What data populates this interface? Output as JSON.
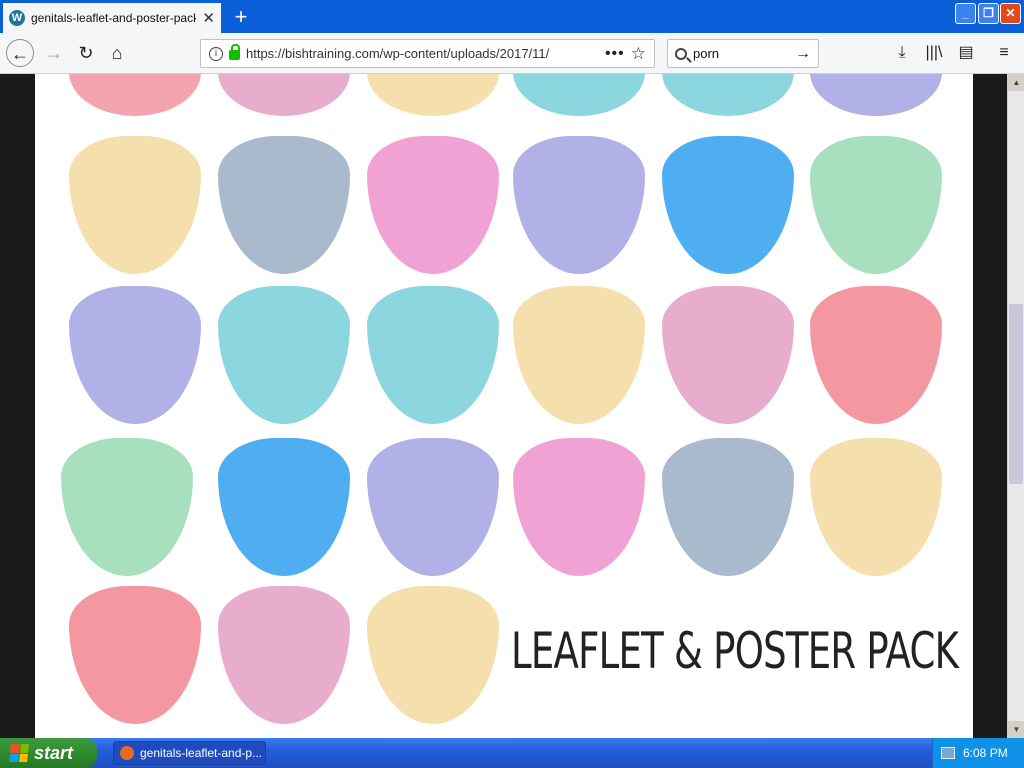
{
  "browser": {
    "tab_title": "genitals-leaflet-and-poster-pack.p",
    "url": "https://bishtraining.com/wp-content/uploads/2017/11/",
    "search_value": "porn"
  },
  "icons": {
    "tab_favicon": "wordpress-icon",
    "tab_close": "close-icon",
    "new_tab": "plus-icon",
    "back": "arrow-left-icon",
    "forward": "arrow-right-icon",
    "reload": "reload-icon",
    "home": "home-icon",
    "site_info": "info-icon",
    "secure": "lock-icon",
    "page_actions": "more-icon",
    "bookmark": "star-icon",
    "search": "search-icon",
    "search_go": "arrow-right-icon",
    "downloads": "download-icon",
    "library": "library-icon",
    "sidebar": "sidebar-icon",
    "menu": "hamburger-icon"
  },
  "page": {
    "headline": "LEAFLET & POSTER PACK"
  },
  "palette": {
    "pink": "#f29aa5",
    "rose": "#e6a3c8",
    "yellow": "#f3dca4",
    "teal": "#7fd1dc",
    "lavender": "#a9a7e4",
    "slate": "#9fb2c6",
    "magenta": "#ee98cf",
    "blue": "#3ba5ef",
    "green": "#9fdcb8",
    "red": "#f28d96"
  },
  "taskbar": {
    "start_label": "start",
    "window_label": "genitals-leaflet-and-p...",
    "clock": "6:08 PM"
  }
}
